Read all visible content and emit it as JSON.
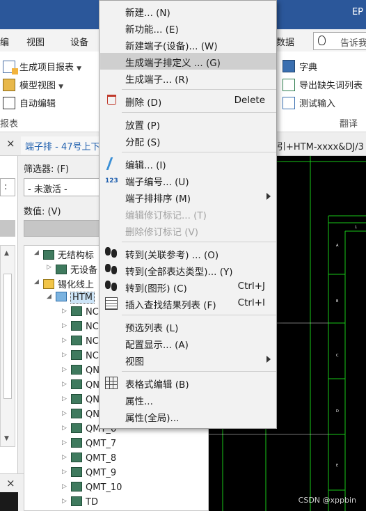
{
  "app": {
    "title_partial": "EP"
  },
  "ribbon": {
    "tabs": [
      "编",
      "视图",
      "设备",
      "数据"
    ],
    "search_placeholder": "告诉我",
    "left_group": {
      "items": [
        {
          "label": "生成项目报表",
          "icon": "report-doc-icon",
          "dropdown": true
        },
        {
          "label": "模型视图",
          "icon": "model-cube-icon",
          "dropdown": true
        },
        {
          "label": "自动编辑",
          "icon": "auto-edit-icon",
          "dropdown": false
        }
      ],
      "group_label": "报表"
    },
    "right_group": {
      "items": [
        {
          "label": "字典",
          "icon": "dictionary-book-icon"
        },
        {
          "label": "导出缺失词列表",
          "icon": "export-list-icon"
        },
        {
          "label": "测试输入",
          "icon": "test-input-icon"
        }
      ],
      "group_label": "翻译"
    }
  },
  "panes": {
    "navigator_tab": "端子排 - 47号上下",
    "document_tab": "引+HTM-xxxx&DJ/3",
    "close_glyph": "×"
  },
  "navigator": {
    "filter_label": "筛选器: (F)",
    "filter_value": "- 未激活 -",
    "value_label": "数值: (V)",
    "tree": [
      {
        "label": "无结构标",
        "level": 0,
        "expanded": true,
        "icon": "green"
      },
      {
        "label": "无设备",
        "level": 1,
        "expanded": false,
        "icon": "green"
      },
      {
        "label": "锡化线上",
        "level": 0,
        "expanded": true,
        "icon": "gold"
      },
      {
        "label": "HTM",
        "level": 1,
        "expanded": true,
        "icon": "selected",
        "selected": true
      },
      {
        "label": "NC",
        "level": 2,
        "expanded": false,
        "icon": "green"
      },
      {
        "label": "NC",
        "level": 2,
        "expanded": false,
        "icon": "green"
      },
      {
        "label": "NC",
        "level": 2,
        "expanded": false,
        "icon": "green"
      },
      {
        "label": "NC",
        "level": 2,
        "expanded": false,
        "icon": "green"
      },
      {
        "label": "QN",
        "level": 2,
        "expanded": false,
        "icon": "green"
      },
      {
        "label": "QN",
        "level": 2,
        "expanded": false,
        "icon": "green"
      },
      {
        "label": "QN",
        "level": 2,
        "expanded": false,
        "icon": "green"
      },
      {
        "label": "QN",
        "level": 2,
        "expanded": false,
        "icon": "green"
      },
      {
        "label": "QMT_6",
        "level": 2,
        "expanded": false,
        "icon": "green"
      },
      {
        "label": "QMT_7",
        "level": 2,
        "expanded": false,
        "icon": "green"
      },
      {
        "label": "QMT_8",
        "level": 2,
        "expanded": false,
        "icon": "green"
      },
      {
        "label": "QMT_9",
        "level": 2,
        "expanded": false,
        "icon": "green"
      },
      {
        "label": "QMT_10",
        "level": 2,
        "expanded": false,
        "icon": "green"
      },
      {
        "label": "TD",
        "level": 2,
        "expanded": false,
        "icon": "green"
      }
    ]
  },
  "context_menu": {
    "items": [
      {
        "label": "新建... (N)"
      },
      {
        "label": "新功能... (E)"
      },
      {
        "label": "新建端子(设备)... (W)"
      },
      {
        "label": "生成端子排定义 ... (G)",
        "highlighted": true
      },
      {
        "label": "生成端子... (R)"
      },
      {
        "separator": true
      },
      {
        "label": "删除 (D)",
        "shortcut": "Delete",
        "icon": "trash-icon"
      },
      {
        "separator": true
      },
      {
        "label": "放置 (P)"
      },
      {
        "label": "分配 (S)"
      },
      {
        "separator": true
      },
      {
        "label": "编辑... (I)",
        "icon": "edit-pen-icon"
      },
      {
        "label": "端子编号... (U)",
        "icon": "numbering-icon"
      },
      {
        "label": "端子排排序 (M)",
        "submenu": true
      },
      {
        "label": "编辑修订标记... (T)",
        "disabled": true
      },
      {
        "label": "删除修订标记 (V)",
        "disabled": true
      },
      {
        "separator": true
      },
      {
        "label": "转到(关联参考) ... (O)",
        "icon": "goto-footsteps-icon"
      },
      {
        "label": "转到(全部表达类型)... (Y)",
        "icon": "goto-all-icon"
      },
      {
        "label": "转到(图形) (C)",
        "shortcut": "Ctrl+J",
        "icon": "goto-graphic-icon"
      },
      {
        "label": "插入查找结果列表 (F)",
        "shortcut": "Ctrl+I",
        "icon": "insert-list-icon"
      },
      {
        "separator": true
      },
      {
        "label": "预选列表 (L)"
      },
      {
        "label": "配置显示... (A)"
      },
      {
        "label": "视图",
        "submenu": true
      },
      {
        "separator": true
      },
      {
        "label": "表格式编辑 (B)",
        "icon": "table-grid-icon"
      },
      {
        "label": "属性..."
      },
      {
        "label": "属性(全局)..."
      }
    ],
    "num_icon_text": "123"
  },
  "drawing": {
    "line_color": "#19c819",
    "labels": [
      "1",
      "A",
      "B",
      "C",
      "D",
      "E"
    ]
  },
  "watermark": "CSDN @xppbin"
}
